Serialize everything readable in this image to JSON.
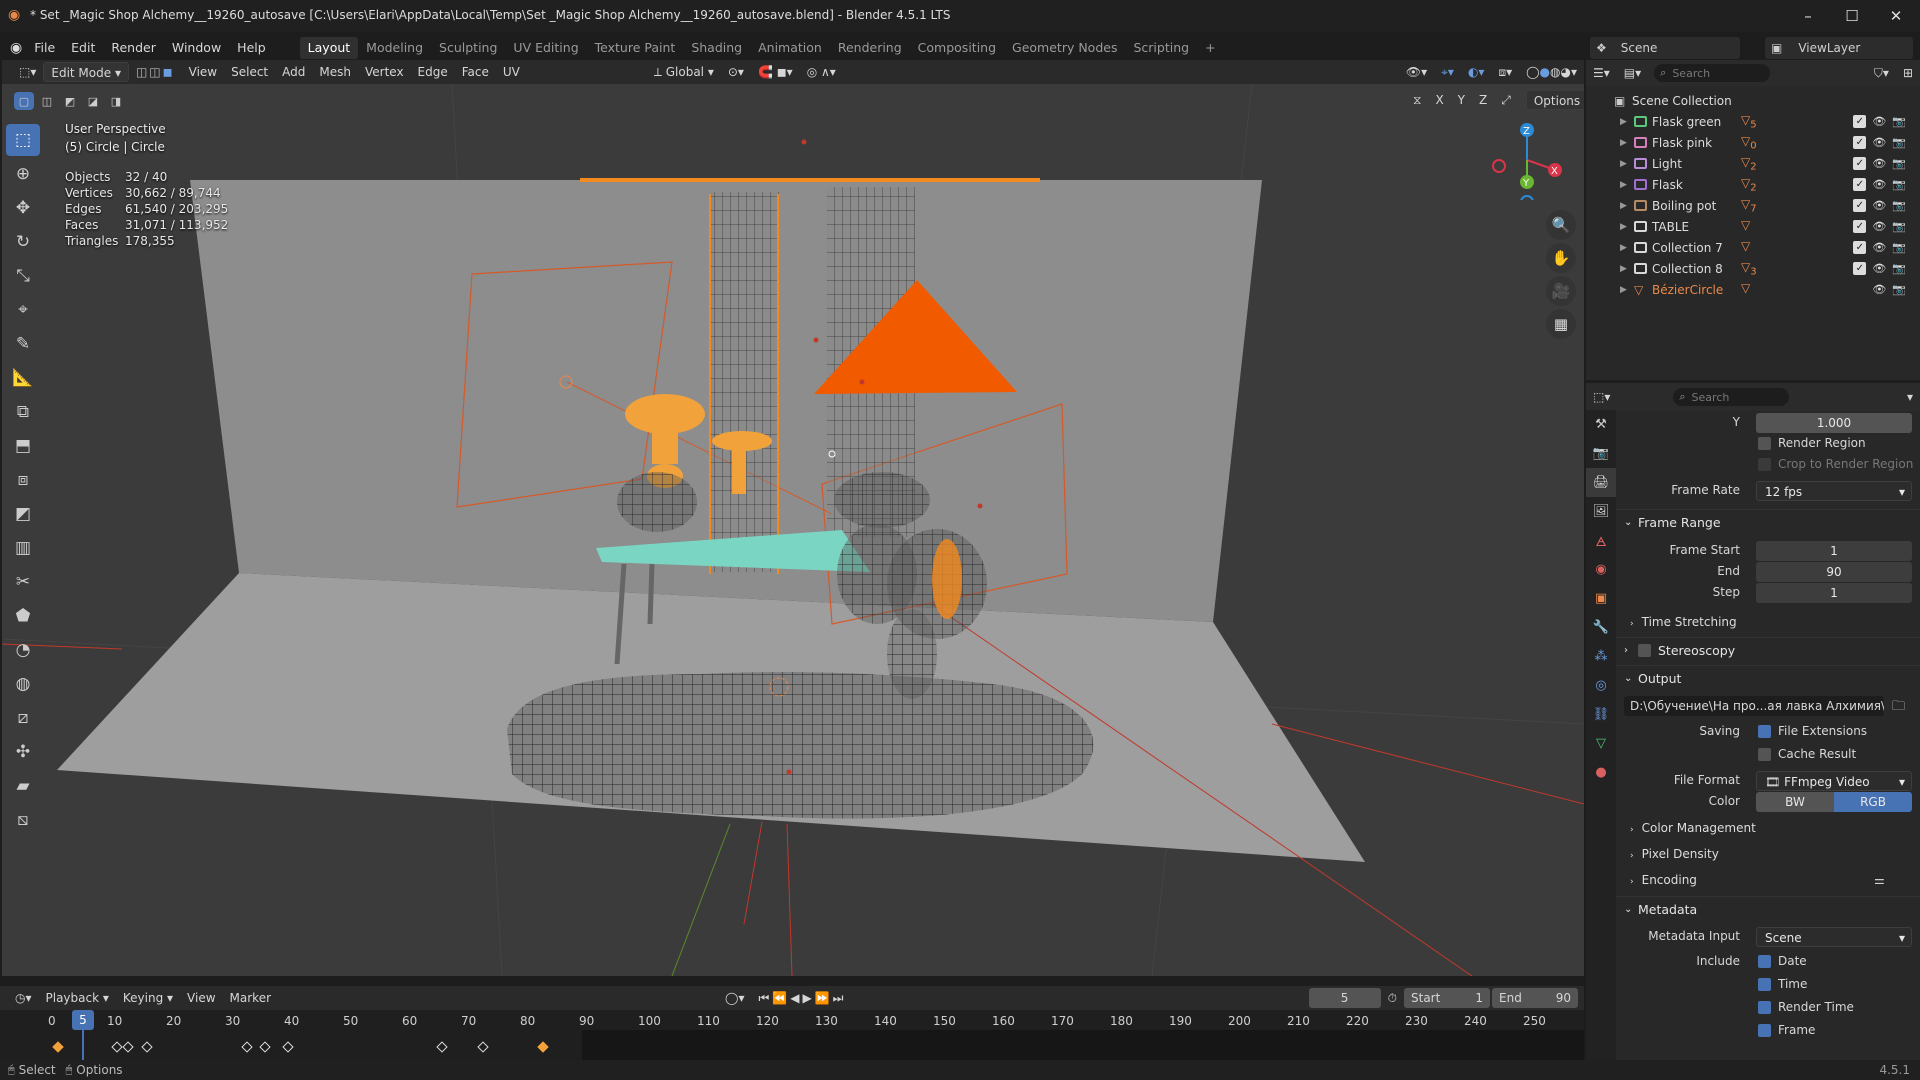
{
  "window": {
    "title": "* Set _Magic Shop Alchemy__19260_autosave [C:\\Users\\Elari\\AppData\\Local\\Temp\\Set _Magic Shop Alchemy__19260_autosave.blend] - Blender 4.5.1 LTS",
    "minimize": "–",
    "maximize": "☐",
    "close": "✕"
  },
  "menubar": {
    "items": [
      "File",
      "Edit",
      "Render",
      "Window",
      "Help"
    ],
    "workspaces": [
      "Layout",
      "Modeling",
      "Sculpting",
      "UV Editing",
      "Texture Paint",
      "Shading",
      "Animation",
      "Rendering",
      "Compositing",
      "Geometry Nodes",
      "Scripting"
    ],
    "active_workspace": "Layout",
    "add": "+",
    "scene": "Scene",
    "view_layer": "ViewLayer"
  },
  "viewport_header": {
    "mode": "Edit Mode",
    "menus": [
      "View",
      "Select",
      "Add",
      "Mesh",
      "Vertex",
      "Edge",
      "Face",
      "UV"
    ],
    "transform": "Global",
    "options": "Options",
    "axes": [
      "X",
      "Y",
      "Z"
    ]
  },
  "overlay": {
    "perspective": "User Perspective",
    "object": "(5) Circle | Circle"
  },
  "stats": [
    {
      "k": "Objects",
      "v": "32 / 40"
    },
    {
      "k": "Vertices",
      "v": "30,662 / 89,744"
    },
    {
      "k": "Edges",
      "v": "61,540 / 203,295"
    },
    {
      "k": "Faces",
      "v": "31,071 / 113,952"
    },
    {
      "k": "Triangles",
      "v": "178,355"
    }
  ],
  "gizmo": {
    "x": "X",
    "y": "Y",
    "z": "Z"
  },
  "outliner": {
    "search_placeholder": "Search",
    "root": "Scene Collection",
    "items": [
      {
        "name": "Flask green",
        "color": "#59c97a",
        "count": "5"
      },
      {
        "name": "Flask pink",
        "color": "#d97fbf",
        "count": "0"
      },
      {
        "name": "Light",
        "color": "#b98dd9",
        "count": "2"
      },
      {
        "name": "Flask",
        "color": "#a070d0",
        "count": "2"
      },
      {
        "name": "Boiling pot",
        "color": "#b88a64",
        "count": "7"
      },
      {
        "name": "TABLE",
        "color": "#d8d8d8",
        "count": ""
      },
      {
        "name": "Collection 7",
        "color": "#d8d8d8",
        "count": ""
      },
      {
        "name": "Collection 8",
        "color": "#d8d8d8",
        "count": "3"
      },
      {
        "name": "BézierCircle",
        "color": "#e8894a",
        "count": ""
      }
    ]
  },
  "properties": {
    "search_placeholder": "Search",
    "y_label": "Y",
    "y_value": "1.000",
    "render_region": "Render Region",
    "crop_region": "Crop to Render Region",
    "frame_rate_label": "Frame Rate",
    "frame_rate": "12 fps",
    "frame_range": "Frame Range",
    "frame_start_label": "Frame Start",
    "frame_start": "1",
    "end_label": "End",
    "end": "90",
    "step_label": "Step",
    "step": "1",
    "time_stretching": "Time Stretching",
    "stereoscopy": "Stereoscopy",
    "output": "Output",
    "output_path": "D:\\Обучение\\На про...ая лавка  Алхимия\\",
    "saving_label": "Saving",
    "file_extensions": "File Extensions",
    "cache_result": "Cache Result",
    "file_format_label": "File Format",
    "file_format": "FFmpeg Video",
    "color_label": "Color",
    "bw": "BW",
    "rgb": "RGB",
    "color_management": "Color Management",
    "pixel_density": "Pixel Density",
    "encoding": "Encoding",
    "metadata": "Metadata",
    "metadata_input_label": "Metadata Input",
    "metadata_input": "Scene",
    "include_label": "Include",
    "include_items": [
      "Date",
      "Time",
      "Render Time",
      "Frame"
    ]
  },
  "timeline": {
    "menus": [
      "Playback",
      "Keying",
      "View",
      "Marker"
    ],
    "current_frame": "5",
    "start_label": "Start",
    "start": "1",
    "end_label": "End",
    "end": "90",
    "ticks": [
      "0",
      "10",
      "20",
      "30",
      "40",
      "50",
      "60",
      "70",
      "80",
      "90",
      "100",
      "110",
      "120",
      "130",
      "140",
      "150",
      "160",
      "170",
      "180",
      "190",
      "200",
      "210",
      "220",
      "230",
      "240",
      "250"
    ],
    "cursor": "5"
  },
  "statusbar": {
    "select": "Select",
    "options": "Options",
    "version": "4.5.1"
  }
}
